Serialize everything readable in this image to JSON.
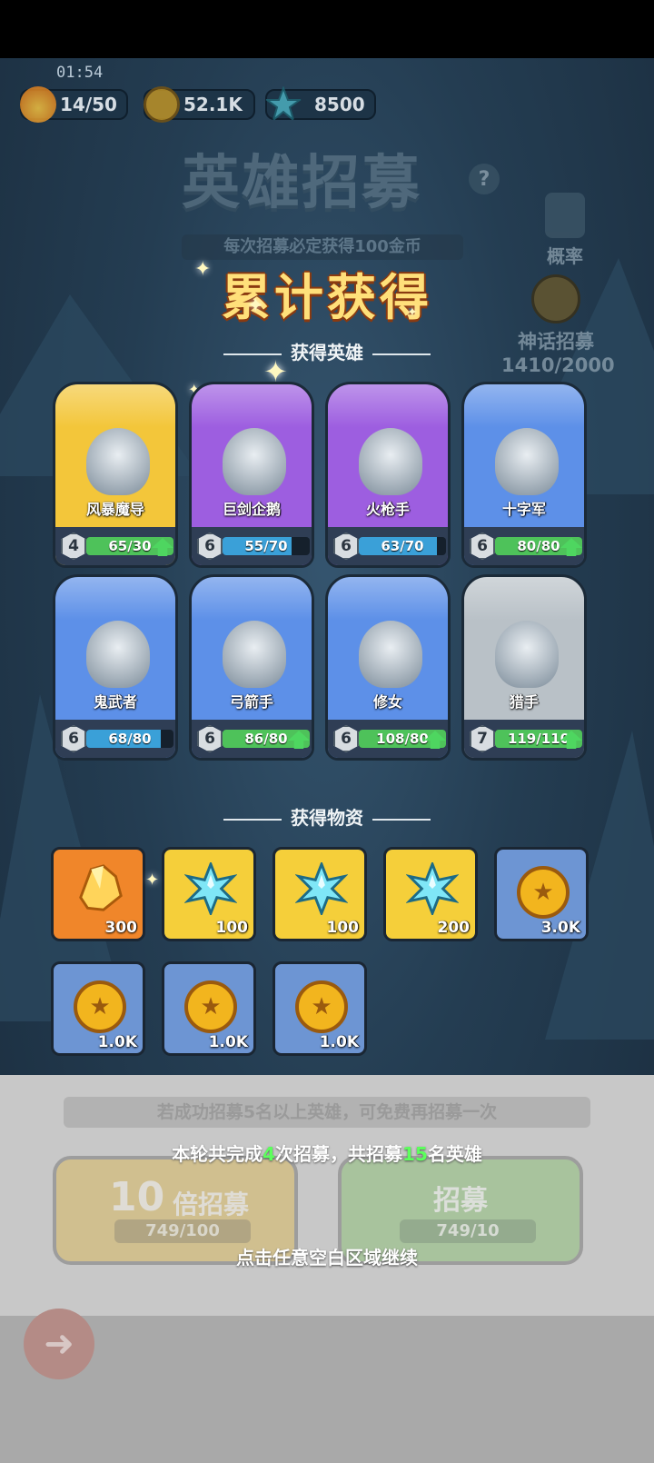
{
  "status": {
    "timer": "01:54"
  },
  "resources": [
    {
      "icon": "energy-flame-icon",
      "value": "14/50"
    },
    {
      "icon": "gold-coin-icon",
      "value": "52.1K"
    },
    {
      "icon": "crystal-gem-icon",
      "value": "8500"
    }
  ],
  "background": {
    "title": "英雄招募",
    "subtitle": "每次招募必定获得100金币",
    "probability_label": "概率",
    "mythic_label": "神话招募",
    "mythic_progress": "1410/2000"
  },
  "overlay": {
    "title": "累计获得",
    "heroes_header": "获得英雄",
    "items_header": "获得物资"
  },
  "heroes": [
    {
      "name": "风暴魔导",
      "level": "4",
      "progress": "65/30",
      "fill": 1.0,
      "can_upgrade": true,
      "rarity_color": "#f3c63a"
    },
    {
      "name": "巨剑企鹅",
      "level": "6",
      "progress": "55/70",
      "fill": 0.79,
      "can_upgrade": false,
      "rarity_color": "#9d5ee0"
    },
    {
      "name": "火枪手",
      "level": "6",
      "progress": "63/70",
      "fill": 0.9,
      "can_upgrade": false,
      "rarity_color": "#9d5ee0"
    },
    {
      "name": "十字军",
      "level": "6",
      "progress": "80/80",
      "fill": 1.0,
      "can_upgrade": true,
      "rarity_color": "#5d90e8"
    },
    {
      "name": "鬼武者",
      "level": "6",
      "progress": "68/80",
      "fill": 0.85,
      "can_upgrade": false,
      "rarity_color": "#5d90e8"
    },
    {
      "name": "弓箭手",
      "level": "6",
      "progress": "86/80",
      "fill": 1.0,
      "can_upgrade": true,
      "rarity_color": "#5d90e8"
    },
    {
      "name": "修女",
      "level": "6",
      "progress": "108/80",
      "fill": 1.0,
      "can_upgrade": true,
      "rarity_color": "#5d90e8"
    },
    {
      "name": "猎手",
      "level": "7",
      "progress": "119/110",
      "fill": 1.0,
      "can_upgrade": true,
      "rarity_color": "#b9c1c7"
    }
  ],
  "items": [
    {
      "type": "orange-crystal-icon",
      "qty": "300",
      "bg": "#f0862a"
    },
    {
      "type": "blue-crystal-icon",
      "qty": "100",
      "bg": "#f5cf3a"
    },
    {
      "type": "blue-crystal-icon",
      "qty": "100",
      "bg": "#f5cf3a"
    },
    {
      "type": "blue-crystal-icon",
      "qty": "200",
      "bg": "#f5cf3a"
    },
    {
      "type": "gold-coin-icon",
      "qty": "3.0K",
      "bg": "#6d95d3"
    },
    {
      "type": "gold-coin-icon",
      "qty": "1.0K",
      "bg": "#6d95d3"
    },
    {
      "type": "gold-coin-icon",
      "qty": "1.0K",
      "bg": "#6d95d3"
    },
    {
      "type": "gold-coin-icon",
      "qty": "1.0K",
      "bg": "#6d95d3"
    }
  ],
  "bottom": {
    "free_note": "若成功招募5名以上英雄，可免费再招募一次",
    "summary_prefix": "本轮共完成",
    "summary_count": "4",
    "summary_mid": "次招募，共招募",
    "summary_heroes": "15",
    "summary_suffix": "名英雄",
    "ten_recruit_num": "10",
    "ten_recruit_label": "倍招募",
    "ten_recruit_cost": "749/100",
    "single_recruit_label": "招募",
    "single_recruit_cost": "749/10",
    "continue_hint": "点击任意空白区域继续"
  }
}
